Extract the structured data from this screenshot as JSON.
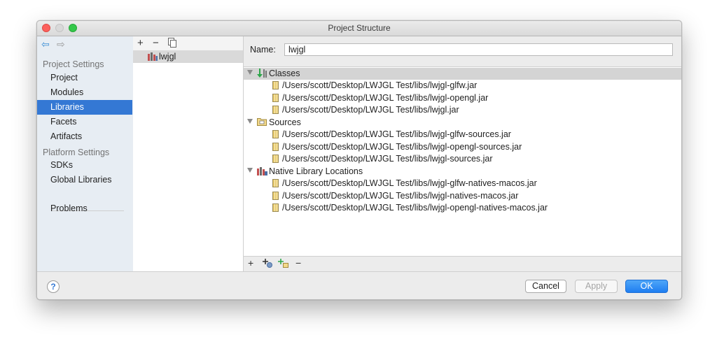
{
  "window": {
    "title": "Project Structure"
  },
  "nav": {
    "sections": [
      {
        "header": "Project Settings",
        "items": [
          "Project",
          "Modules",
          "Libraries",
          "Facets",
          "Artifacts"
        ]
      },
      {
        "header": "Platform Settings",
        "items": [
          "SDKs",
          "Global Libraries"
        ]
      }
    ],
    "extra_item": "Problems",
    "selected": "Libraries"
  },
  "middle": {
    "toolbar": [
      "add",
      "remove",
      "copy"
    ],
    "libraries": [
      "lwjgl"
    ]
  },
  "details": {
    "name_label": "Name:",
    "name_value": "lwjgl",
    "categories": [
      {
        "label": "Classes",
        "entries": [
          "/Users/scott/Desktop/LWJGL Test/libs/lwjgl-glfw.jar",
          "/Users/scott/Desktop/LWJGL Test/libs/lwjgl-opengl.jar",
          "/Users/scott/Desktop/LWJGL Test/libs/lwjgl.jar"
        ]
      },
      {
        "label": "Sources",
        "entries": [
          "/Users/scott/Desktop/LWJGL Test/libs/lwjgl-glfw-sources.jar",
          "/Users/scott/Desktop/LWJGL Test/libs/lwjgl-opengl-sources.jar",
          "/Users/scott/Desktop/LWJGL Test/libs/lwjgl-sources.jar"
        ]
      },
      {
        "label": "Native Library Locations",
        "entries": [
          "/Users/scott/Desktop/LWJGL Test/libs/lwjgl-glfw-natives-macos.jar",
          "/Users/scott/Desktop/LWJGL Test/libs/lwjgl-natives-macos.jar",
          "/Users/scott/Desktop/LWJGL Test/libs/lwjgl-opengl-natives-macos.jar"
        ]
      }
    ]
  },
  "footer": {
    "cancel": "Cancel",
    "apply": "Apply",
    "ok": "OK"
  },
  "colors": {
    "accent": "#3478d4",
    "ok_button": "#1f7ef1"
  }
}
